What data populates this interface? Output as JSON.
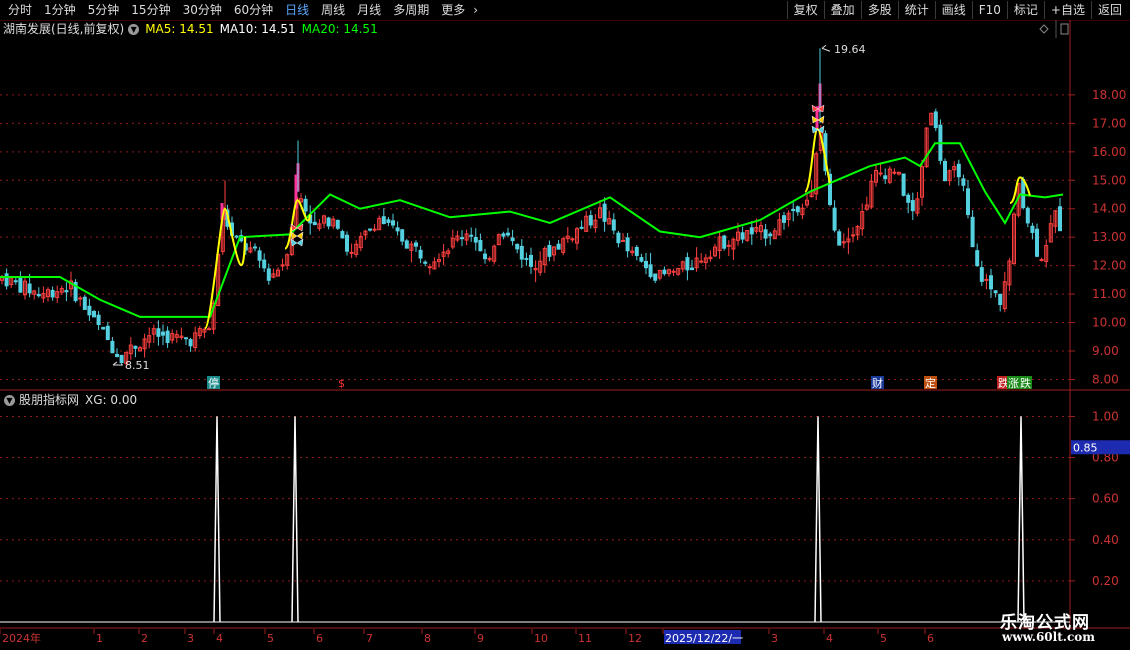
{
  "toolbar": {
    "periods": [
      "分时",
      "1分钟",
      "5分钟",
      "15分钟",
      "30分钟",
      "60分钟",
      "日线",
      "周线",
      "月线",
      "多周期",
      "更多"
    ],
    "active_period": "日线",
    "more_chevron": "›",
    "right_buttons": [
      "复权",
      "叠加",
      "多股",
      "统计",
      "画线",
      "F10",
      "标记",
      "+自选",
      "返回"
    ]
  },
  "header": {
    "stock": "湖南发展(日线,前复权)",
    "ma5": "MA5: 14.51",
    "ma10": "MA10: 14.51",
    "ma20": "MA20: 14.51"
  },
  "indicator_header": {
    "name": "股朋指标网",
    "value": "XG: 0.00"
  },
  "price_axis": {
    "ticks": [
      "18.00",
      "17.00",
      "16.00",
      "15.00",
      "14.00",
      "13.00",
      "12.00",
      "11.00",
      "10.00",
      "9.00",
      "8.00"
    ]
  },
  "indicator_axis": {
    "ticks": [
      "1.00",
      "0.80",
      "0.60",
      "0.40",
      "0.20"
    ],
    "current": "0.85"
  },
  "annotations": {
    "high": "19.64",
    "low": "8.51"
  },
  "markers": {
    "m1": "停",
    "m2": "$",
    "m3": "财",
    "m4": "定",
    "m5": "跌",
    "m6": "涨",
    "m7": "跌"
  },
  "time_axis": {
    "labels": [
      "2024年",
      "1",
      "2",
      "3",
      "4",
      "5",
      "6",
      "7",
      "8",
      "9",
      "10",
      "11",
      "12",
      "2025/12/22/一",
      "3",
      "4",
      "5",
      "6"
    ]
  },
  "watermark": {
    "line1": "乐淘公式网",
    "line2": "www.60lt.com"
  },
  "colors": {
    "up": "#ff4040",
    "down": "#54d0e0",
    "ma5": "#ffff00",
    "ma20": "#00ff00",
    "signal": "#ffffff",
    "grid": "#8b1a1a"
  },
  "chart_data": [
    {
      "type": "candlestick",
      "title": "湖南发展(日线,前复权)",
      "period": "daily",
      "ylim": [
        7.7,
        20.0
      ],
      "series": [
        {
          "name": "MA5",
          "values_last": 14.51
        },
        {
          "name": "MA10",
          "values_last": 14.51
        },
        {
          "name": "MA20",
          "values_last": 14.51
        }
      ],
      "annotations": {
        "max": 19.64,
        "min": 8.51
      },
      "x_labels": [
        "2024年",
        "1",
        "2",
        "3",
        "4",
        "5",
        "6",
        "7",
        "8",
        "9",
        "10",
        "11",
        "12",
        "2025/12/22/一",
        "3",
        "4",
        "5",
        "6"
      ],
      "trend_keypoints": [
        {
          "x": 0,
          "y": 11.6
        },
        {
          "x": 40,
          "y": 11.0
        },
        {
          "x": 70,
          "y": 11.3
        },
        {
          "x": 95,
          "y": 10.0
        },
        {
          "x": 120,
          "y": 8.8
        },
        {
          "x": 150,
          "y": 9.6
        },
        {
          "x": 190,
          "y": 9.4
        },
        {
          "x": 212,
          "y": 9.9
        },
        {
          "x": 222,
          "y": 14.0
        },
        {
          "x": 232,
          "y": 13.0
        },
        {
          "x": 255,
          "y": 12.4
        },
        {
          "x": 270,
          "y": 11.6
        },
        {
          "x": 285,
          "y": 12.2
        },
        {
          "x": 298,
          "y": 14.6
        },
        {
          "x": 315,
          "y": 13.3
        },
        {
          "x": 335,
          "y": 13.8
        },
        {
          "x": 350,
          "y": 12.3
        },
        {
          "x": 378,
          "y": 13.7
        },
        {
          "x": 400,
          "y": 13.0
        },
        {
          "x": 430,
          "y": 12.2
        },
        {
          "x": 470,
          "y": 13.3
        },
        {
          "x": 485,
          "y": 12.0
        },
        {
          "x": 500,
          "y": 13.4
        },
        {
          "x": 530,
          "y": 12.0
        },
        {
          "x": 560,
          "y": 12.8
        },
        {
          "x": 590,
          "y": 13.6
        },
        {
          "x": 600,
          "y": 13.9
        },
        {
          "x": 630,
          "y": 12.4
        },
        {
          "x": 660,
          "y": 11.6
        },
        {
          "x": 690,
          "y": 12.0
        },
        {
          "x": 720,
          "y": 12.8
        },
        {
          "x": 745,
          "y": 13.1
        },
        {
          "x": 770,
          "y": 13.2
        },
        {
          "x": 800,
          "y": 14.2
        },
        {
          "x": 812,
          "y": 14.5
        },
        {
          "x": 820,
          "y": 17.0
        },
        {
          "x": 830,
          "y": 14.0
        },
        {
          "x": 840,
          "y": 12.8
        },
        {
          "x": 860,
          "y": 13.6
        },
        {
          "x": 875,
          "y": 15.2
        },
        {
          "x": 895,
          "y": 15.4
        },
        {
          "x": 915,
          "y": 13.6
        },
        {
          "x": 930,
          "y": 17.8
        },
        {
          "x": 945,
          "y": 15.0
        },
        {
          "x": 960,
          "y": 15.4
        },
        {
          "x": 975,
          "y": 12.0
        },
        {
          "x": 990,
          "y": 11.2
        },
        {
          "x": 1000,
          "y": 10.8
        },
        {
          "x": 1010,
          "y": 12.2
        },
        {
          "x": 1018,
          "y": 15.0
        },
        {
          "x": 1028,
          "y": 13.6
        },
        {
          "x": 1040,
          "y": 12.2
        },
        {
          "x": 1055,
          "y": 13.8
        },
        {
          "x": 1063,
          "y": 13.2
        }
      ],
      "ma20_keypoints": [
        {
          "x": 0,
          "y": 11.6
        },
        {
          "x": 60,
          "y": 11.6
        },
        {
          "x": 100,
          "y": 10.8
        },
        {
          "x": 140,
          "y": 10.2
        },
        {
          "x": 210,
          "y": 10.2
        },
        {
          "x": 240,
          "y": 13.0
        },
        {
          "x": 290,
          "y": 13.1
        },
        {
          "x": 330,
          "y": 14.5
        },
        {
          "x": 360,
          "y": 14.0
        },
        {
          "x": 400,
          "y": 14.3
        },
        {
          "x": 450,
          "y": 13.7
        },
        {
          "x": 510,
          "y": 13.9
        },
        {
          "x": 550,
          "y": 13.5
        },
        {
          "x": 610,
          "y": 14.4
        },
        {
          "x": 660,
          "y": 13.2
        },
        {
          "x": 700,
          "y": 13.0
        },
        {
          "x": 760,
          "y": 13.6
        },
        {
          "x": 810,
          "y": 14.6
        },
        {
          "x": 850,
          "y": 15.2
        },
        {
          "x": 870,
          "y": 15.5
        },
        {
          "x": 905,
          "y": 15.8
        },
        {
          "x": 920,
          "y": 15.5
        },
        {
          "x": 935,
          "y": 16.3
        },
        {
          "x": 960,
          "y": 16.3
        },
        {
          "x": 985,
          "y": 14.6
        },
        {
          "x": 1005,
          "y": 13.5
        },
        {
          "x": 1020,
          "y": 14.5
        },
        {
          "x": 1045,
          "y": 14.4
        },
        {
          "x": 1063,
          "y": 14.5
        }
      ],
      "ma5_spikes": [
        {
          "x_start": 205,
          "x_end": 245,
          "low": 9.8,
          "high": 14.0
        },
        {
          "x_start": 285,
          "x_end": 310,
          "low": 12.6,
          "high": 14.3
        },
        {
          "x_start": 805,
          "x_end": 830,
          "low": 14.6,
          "high": 16.8
        },
        {
          "x_start": 1010,
          "x_end": 1030,
          "low": 14.2,
          "high": 15.1
        }
      ]
    },
    {
      "type": "line",
      "title": "股朋指标网",
      "series": [
        {
          "name": "XG",
          "last": 0.0
        }
      ],
      "ylim": [
        0,
        1.08
      ],
      "spikes": [
        {
          "x": 217,
          "value": 1.0
        },
        {
          "x": 295,
          "value": 1.0
        },
        {
          "x": 818,
          "value": 1.0
        },
        {
          "x": 1021,
          "value": 1.0
        }
      ]
    }
  ]
}
